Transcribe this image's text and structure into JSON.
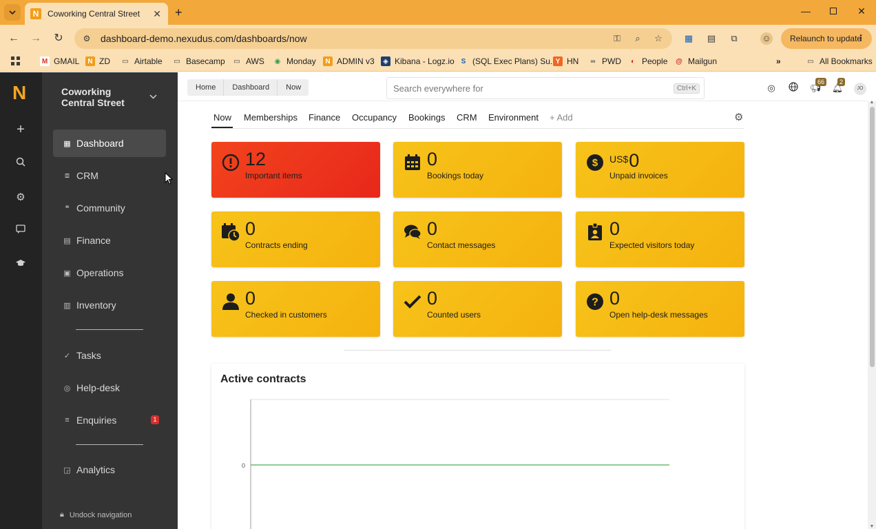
{
  "browser": {
    "tab_title": "Coworking Central Street",
    "favicon_letter": "N",
    "url": "dashboard-demo.nexudus.com/dashboards/now",
    "relaunch_label": "Relaunch to update",
    "bookmarks": [
      "GMAIL",
      "ZD",
      "Airtable",
      "Basecamp",
      "AWS",
      "Monday",
      "ADMIN v3",
      "Kibana - Logz.io",
      "(SQL Exec Plans) Su...",
      "HN",
      "PWD",
      "People",
      "Mailgun"
    ],
    "all_bookmarks": "All Bookmarks"
  },
  "rail": {
    "logo": "N"
  },
  "sidebar": {
    "location_line1": "Coworking",
    "location_line2": "Central Street",
    "items": [
      {
        "label": "Dashboard"
      },
      {
        "label": "CRM"
      },
      {
        "label": "Community"
      },
      {
        "label": "Finance"
      },
      {
        "label": "Operations"
      },
      {
        "label": "Inventory"
      },
      {
        "label": "Tasks"
      },
      {
        "label": "Help-desk"
      },
      {
        "label": "Enquiries",
        "badge": "1"
      },
      {
        "label": "Analytics"
      }
    ],
    "undock": "Undock navigation"
  },
  "topbar": {
    "breadcrumbs": [
      "Home",
      "Dashboard",
      "Now"
    ],
    "search_placeholder": "Search everywhere for",
    "search_shortcut": "Ctrl+K",
    "announcements_badge": "66",
    "notifications_badge": "2",
    "avatar_initials": "JO"
  },
  "dashboard_tabs": [
    "Now",
    "Memberships",
    "Finance",
    "Occupancy",
    "Bookings",
    "CRM",
    "Environment",
    "+ Add"
  ],
  "cards": [
    {
      "value": "12",
      "label": "Important items",
      "icon": "alert-icon"
    },
    {
      "value": "0",
      "label": "Bookings today",
      "icon": "calendar-icon"
    },
    {
      "currency": "US$",
      "value": "0",
      "label": "Unpaid invoices",
      "icon": "dollar-icon"
    },
    {
      "value": "0",
      "label": "Contracts ending",
      "icon": "calendar-clock-icon"
    },
    {
      "value": "0",
      "label": "Contact messages",
      "icon": "chat-icon"
    },
    {
      "value": "0",
      "label": "Expected visitors today",
      "icon": "badge-icon"
    },
    {
      "value": "0",
      "label": "Checked in customers",
      "icon": "person-icon"
    },
    {
      "value": "0",
      "label": "Counted users",
      "icon": "check-icon"
    },
    {
      "value": "0",
      "label": "Open help-desk messages",
      "icon": "question-icon"
    }
  ],
  "colors": {
    "accent": "#f4a623",
    "card_yellow": "#f7c31a",
    "card_red": "#e8271b",
    "line": "#4caf50"
  },
  "chart_data": {
    "type": "line",
    "title": "Active contracts",
    "y_ticks": [
      "0"
    ],
    "series": [
      {
        "values": [
          0
        ]
      }
    ]
  }
}
